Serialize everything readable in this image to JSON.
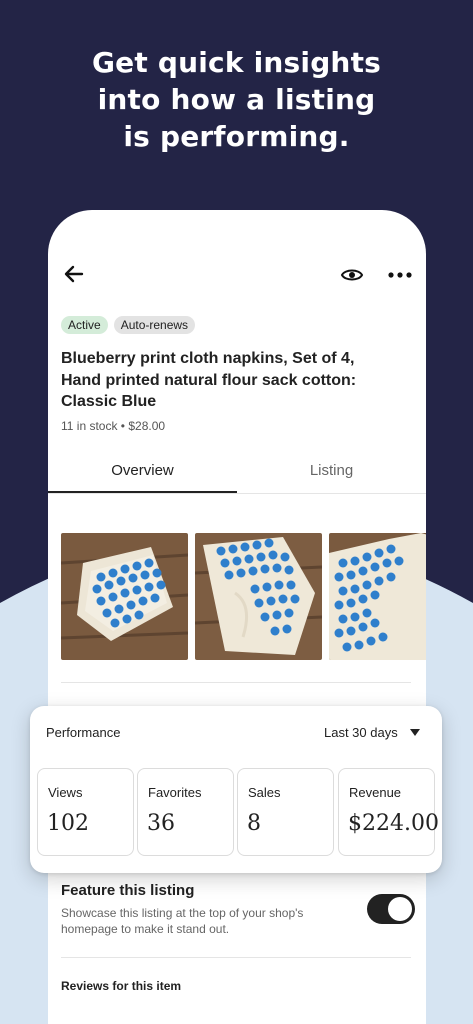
{
  "headline": [
    "Get quick insights",
    "into how a listing",
    "is performing."
  ],
  "colors": {
    "background_dark": "#232446",
    "background_light": "#d6e4f2",
    "active_badge": "#d4ecd9",
    "toggle_on": "#222222"
  },
  "topbar": {
    "back_icon": "arrow-left-icon",
    "preview_icon": "eye-icon",
    "more_icon": "more-horizontal-icon"
  },
  "listing": {
    "badges": [
      "Active",
      "Auto-renews"
    ],
    "title_lines": [
      "Blueberry print cloth napkins, Set of 4,",
      "Hand printed natural flour sack cotton:",
      "Classic Blue"
    ],
    "meta": "11 in stock • $28.00"
  },
  "tabs": [
    {
      "label": "Overview",
      "selected": true
    },
    {
      "label": "Listing",
      "selected": false
    }
  ],
  "performance": {
    "title": "Performance",
    "range": "Last 30 days",
    "stats": [
      {
        "label": "Views",
        "value": "102"
      },
      {
        "label": "Favorites",
        "value": "36"
      },
      {
        "label": "Sales",
        "value": "8"
      },
      {
        "label": "Revenue",
        "value": "$224.00"
      }
    ]
  },
  "feature": {
    "title": "Feature this listing",
    "desc_lines": [
      "Showcase this listing at the top of your shop's",
      "homepage to make it stand out."
    ],
    "toggle_on": true
  },
  "reviews": {
    "title": "Reviews for this item"
  }
}
